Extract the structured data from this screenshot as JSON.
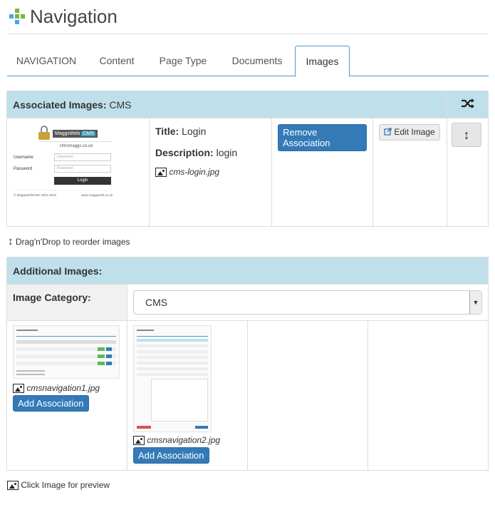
{
  "header": {
    "title": "Navigation"
  },
  "tabs": [
    {
      "label": "NAVIGATION"
    },
    {
      "label": "Content"
    },
    {
      "label": "Page Type"
    },
    {
      "label": "Documents"
    },
    {
      "label": "Images"
    }
  ],
  "associated": {
    "heading_bold": "Associated Images:",
    "heading_value": "CMS",
    "item": {
      "title_label": "Title:",
      "title_value": "Login",
      "description_label": "Description:",
      "description_value": "login",
      "filename": "cms-login.jpg",
      "remove_label": "Remove Association",
      "edit_label": "Edit Image",
      "thumb": {
        "brand": "MaggsWeb",
        "brand_tag": "CMS",
        "site": "chrismaggs.co.uk",
        "username_label": "Username",
        "username_placeholder": "Username",
        "password_label": "Password",
        "password_placeholder": "Password",
        "login_button": "Login",
        "footer_left": "© MaggsWebCMS 2001-2016",
        "footer_right": "www.maggsweb.co.uk"
      }
    }
  },
  "drag_hint": "Drag'n'Drop to reorder images",
  "additional": {
    "heading": "Additional Images:",
    "category_label": "Image Category:",
    "category_value": "CMS",
    "items": [
      {
        "filename": "cmsnavigation1.jpg",
        "button": "Add Association"
      },
      {
        "filename": "cmsnavigation2.jpg",
        "button": "Add Association"
      }
    ]
  },
  "footer_hint": "Click Image for preview",
  "colors": {
    "header_bg": "#bfe0ea",
    "primary": "#337ab7",
    "tab_accent": "#4a9bd0"
  }
}
